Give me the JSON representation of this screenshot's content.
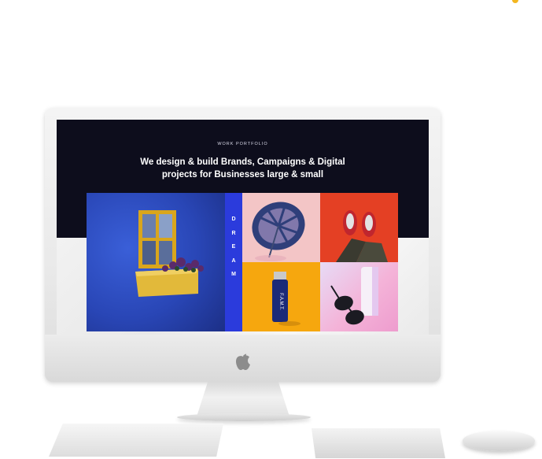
{
  "portfolio": {
    "eyebrow": "WORK PORTFOLIO",
    "headline_line1": "We design & build Brands, Campaigns & Digital",
    "headline_line2": "projects for Businesses large & small",
    "dream_letters": [
      "D",
      "R",
      "E",
      "A",
      "M"
    ],
    "lighter_label": "F.A.M.T."
  },
  "colors": {
    "screen_bg": "#0d0d1c",
    "wall_blue": "#2946b6",
    "dream_blue": "#2b3bdc",
    "leaf_pink": "#f3c5c6",
    "shoes_red": "#e44024",
    "lighter_yellow": "#f6a70e",
    "glasses_lilac": "#e7dbf6"
  },
  "icons": {
    "brand": "apple-logo-icon"
  }
}
